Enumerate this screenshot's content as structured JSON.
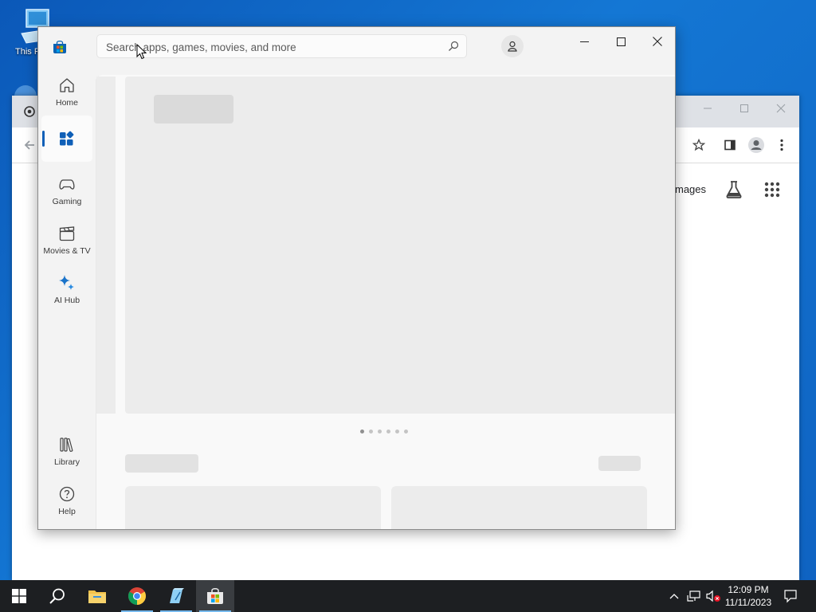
{
  "desktop": {
    "this_pc_label": "This P"
  },
  "chrome": {
    "images_link": "mages"
  },
  "store": {
    "search_placeholder": "Search apps, games, movies, and more",
    "nav": [
      {
        "label": "Home",
        "icon": "home-icon"
      },
      {
        "label": "",
        "icon": "apps-icon",
        "active": true
      },
      {
        "label": "Gaming",
        "icon": "gamepad-icon"
      },
      {
        "label": "Movies & TV",
        "icon": "clapperboard-icon"
      },
      {
        "label": "AI Hub",
        "icon": "sparkle-icon"
      },
      {
        "label": "Library",
        "icon": "library-icon"
      },
      {
        "label": "Help",
        "icon": "help-icon"
      }
    ],
    "carousel": {
      "count": 6,
      "active_index": 0
    }
  },
  "taskbar": {
    "time": "12:09 PM",
    "date": "11/11/2023"
  },
  "colors": {
    "accent": "#0f5fb7",
    "taskbar": "#1d1f22",
    "desktop": "#1572c9"
  }
}
